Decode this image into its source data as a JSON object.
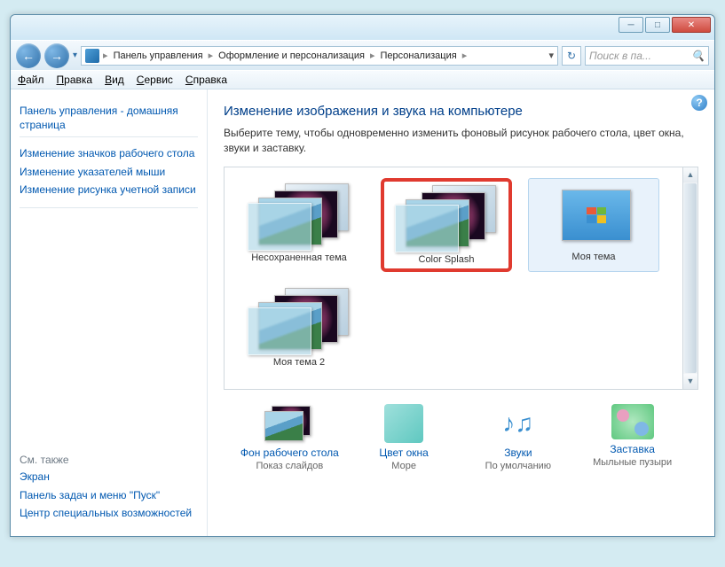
{
  "breadcrumb": {
    "seg1": "Панель управления",
    "seg2": "Оформление и персонализация",
    "seg3": "Персонализация"
  },
  "search": {
    "placeholder": "Поиск в па..."
  },
  "menu": {
    "file": "Файл",
    "edit": "Правка",
    "view": "Вид",
    "tools": "Сервис",
    "help": "Справка"
  },
  "sidebar": {
    "home": "Панель управления - домашняя страница",
    "links": [
      "Изменение значков рабочего стола",
      "Изменение указателей мыши",
      "Изменение рисунка учетной записи"
    ],
    "seealso_h": "См. также",
    "seealso": [
      "Экран",
      "Панель задач и меню \"Пуск\"",
      "Центр специальных возможностей"
    ]
  },
  "content": {
    "heading": "Изменение изображения и звука на компьютере",
    "desc": "Выберите тему, чтобы одновременно изменить фоновый рисунок рабочего стола, цвет окна, звуки и заставку."
  },
  "themes": [
    {
      "label": "Несохраненная тема",
      "type": "stack"
    },
    {
      "label": "Color Splash",
      "type": "stack",
      "selected": true
    },
    {
      "label": "Моя тема",
      "type": "single"
    },
    {
      "label": "Моя тема 2",
      "type": "stack"
    }
  ],
  "bottom": [
    {
      "link": "Фон рабочего стола",
      "sub": "Показ слайдов"
    },
    {
      "link": "Цвет окна",
      "sub": "Море"
    },
    {
      "link": "Звуки",
      "sub": "По умолчанию"
    },
    {
      "link": "Заставка",
      "sub": "Мыльные пузыри"
    }
  ]
}
